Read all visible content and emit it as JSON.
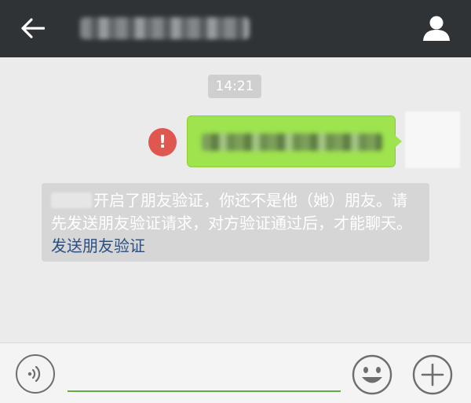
{
  "header": {
    "back_icon": "arrow-left-icon",
    "profile_icon": "person-icon"
  },
  "chat": {
    "timestamp": "14:21",
    "failed_icon_label": "!",
    "system_notice": {
      "main_text": "开启了朋友验证，你还不是他（她）朋友。请先发送朋友验证请求，对方验证通过后，才能聊天。",
      "link_text": "发送朋友验证"
    }
  },
  "input_bar": {
    "voice_icon": "voice-icon",
    "emoji_icon": "smiley-icon",
    "more_icon": "plus-icon",
    "text_value": ""
  },
  "colors": {
    "topbar": "#2f3336",
    "outgoing_bubble": "#9ee44f",
    "error_red": "#e0574f",
    "link_blue": "#2b4f83",
    "input_underline": "#5bb238"
  }
}
